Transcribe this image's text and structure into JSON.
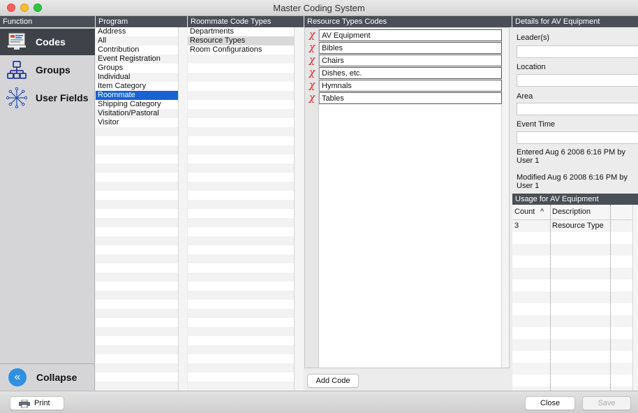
{
  "window": {
    "title": "Master Coding System"
  },
  "headers": {
    "function": "Function",
    "program": "Program",
    "code_types": "Roommate Code Types",
    "codes": "Resource Types Codes",
    "details": "Details for AV Equipment",
    "usage": "Usage for AV Equipment"
  },
  "functions": [
    {
      "label": "Codes",
      "icon": "codes-icon",
      "selected": true
    },
    {
      "label": "Groups",
      "icon": "groups-icon",
      "selected": false
    },
    {
      "label": "User Fields",
      "icon": "user-fields-icon",
      "selected": false
    }
  ],
  "collapse_label": "Collapse",
  "programs": [
    "Address",
    "All",
    "Contribution",
    "Event Registration",
    "Groups",
    "Individual",
    "Item Category",
    "Roommate",
    "Shipping Category",
    "Visitation/Pastoral",
    "Visitor"
  ],
  "programs_selected": "Roommate",
  "code_types": [
    "Departments",
    "Resource Types",
    "Room Configurations"
  ],
  "code_types_selected": "Resource Types",
  "codes": [
    "AV Equipment",
    "Bibles",
    "Chairs",
    "Dishes, etc.",
    "Hymnals",
    "Tables"
  ],
  "add_code_label": "Add Code",
  "details": {
    "leader_label": "Leader(s)",
    "leader_value": "",
    "location_label": "Location",
    "location_value": "",
    "area_label": "Area",
    "area_value": "",
    "event_time_label": "Event Time",
    "event_time_value": "",
    "entered": "Entered Aug 6 2008 6:16 PM by User 1",
    "modified": "Modified Aug 6 2008 6:16 PM by User 1"
  },
  "usage": {
    "col_count": "Count",
    "sort_indicator": "^",
    "col_description": "Description",
    "rows": [
      {
        "count": "3",
        "description": "Resource Type"
      }
    ]
  },
  "bottom": {
    "print_label": "Print",
    "close_label": "Close",
    "save_label": "Save"
  },
  "colors": {
    "header_bg": "#4a4f57",
    "selection": "#1962d1",
    "delete_mark": "#d42020",
    "collapse_button": "#2f8fe0"
  }
}
